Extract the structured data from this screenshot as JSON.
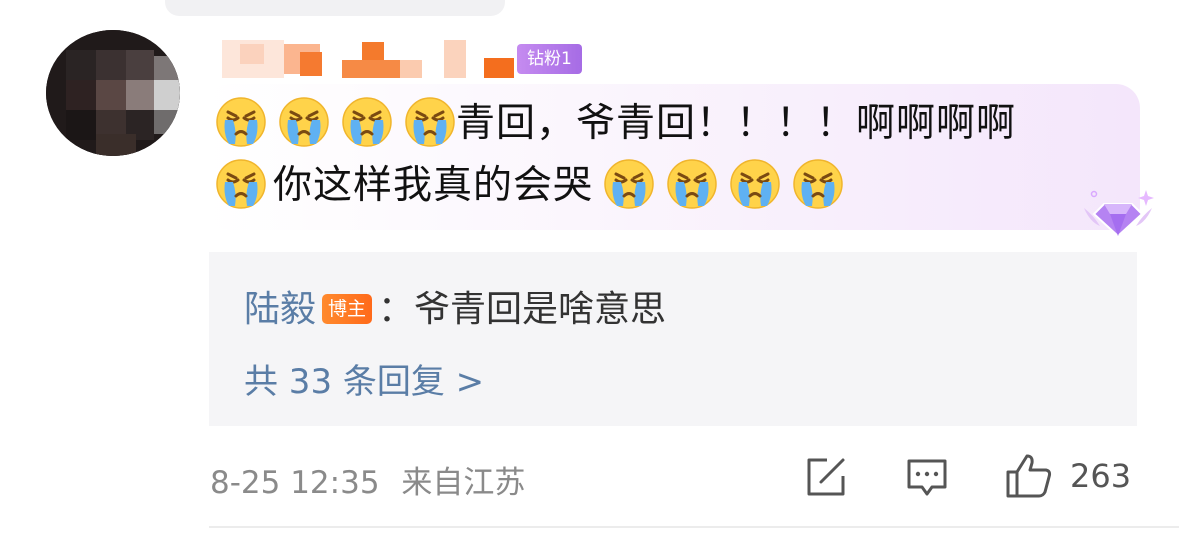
{
  "comment": {
    "fan_badge": "钻粉1",
    "line1_text": "青回，爷青回！！！！啊啊啊啊",
    "line2_text": "你这样我真的会哭",
    "emoji_name": "crying-face-icon"
  },
  "reply_preview": {
    "author": "陆毅",
    "author_badge": "博主",
    "text": "：爷青回是啥意思",
    "more_replies": "共 33 条回复 >"
  },
  "footer": {
    "time": "8-25 12:35",
    "location": "来自江苏",
    "like_count": "263"
  },
  "colors": {
    "link_blue": "#5a7da6",
    "fan_badge_purple": "#b07aea",
    "host_badge_orange": "#ff7a22"
  }
}
